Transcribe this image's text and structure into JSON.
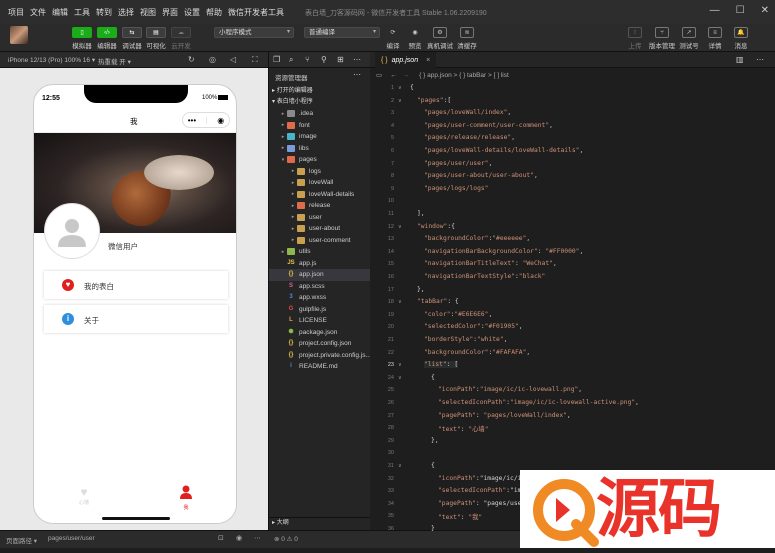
{
  "menu": {
    "items": [
      "项目",
      "文件",
      "编辑",
      "工具",
      "转到",
      "选择",
      "视图",
      "界面",
      "设置",
      "帮助",
      "微信开发者工具"
    ],
    "title": "表白墙_刀客源码网 - 微信开发者工具 Stable 1.06.2209190"
  },
  "toolbar": {
    "simulator": "模拟器",
    "editor": "编辑器",
    "debugger": "调试器",
    "visual": "可视化",
    "cloud": "云开发",
    "mode": "小程序模式",
    "compile": "普通编译",
    "compile_label": "编译",
    "preview": "预览",
    "real_debug": "真机调试",
    "clear_cache": "清缓存",
    "upload": "上传",
    "version": "版本管理",
    "test": "测试号",
    "details": "详情",
    "messages": "消息",
    "right_icon_labels": [
      "⇪",
      "⑂",
      "↗",
      "≡",
      "🔔"
    ]
  },
  "simulator": {
    "device": "iPhone 12/13 (Pro) 100% 16 ▾",
    "hot_reload": "热重载 开 ▾"
  },
  "phone": {
    "time": "12:55",
    "battery": "100%",
    "nav_title": "我",
    "user_name": "微信用户",
    "menu_items": [
      {
        "icon": "heart-icon",
        "label": "我的表白",
        "color": "#e02020"
      },
      {
        "icon": "info-icon",
        "label": "关于",
        "color": "#2f8fdc"
      }
    ],
    "tabs": [
      {
        "label": "心墙",
        "color": "#cccccc"
      },
      {
        "label": "我",
        "color": "#e02020"
      }
    ]
  },
  "bottom": {
    "path_label": "页面路径 ▾",
    "path": "pages/user/user",
    "status": "⊗ 0 ⚠ 0"
  },
  "explorer": {
    "title": "资源管理器",
    "open_editors": "打开的编辑器",
    "project": "表白墙小程序",
    "outline": "大纲",
    "tree": [
      {
        "name": ".idea",
        "depth": 1,
        "type": "folder",
        "color": "#8a8a8a",
        "arrow": "▸"
      },
      {
        "name": "font",
        "depth": 1,
        "type": "folder",
        "color": "#e06b4a",
        "arrow": "▸"
      },
      {
        "name": "image",
        "depth": 1,
        "type": "folder",
        "color": "#4ab3c8",
        "arrow": "▸"
      },
      {
        "name": "libs",
        "depth": 1,
        "type": "folder",
        "color": "#7a9ad8",
        "arrow": "▸"
      },
      {
        "name": "pages",
        "depth": 1,
        "type": "folder",
        "color": "#e06b4a",
        "arrow": "▾"
      },
      {
        "name": "logs",
        "depth": 2,
        "type": "folder",
        "color": "#c8a050",
        "arrow": "▸"
      },
      {
        "name": "loveWall",
        "depth": 2,
        "type": "folder",
        "color": "#c8a050",
        "arrow": "▸"
      },
      {
        "name": "loveWall-details",
        "depth": 2,
        "type": "folder",
        "color": "#c8a050",
        "arrow": "▸"
      },
      {
        "name": "release",
        "depth": 2,
        "type": "folder",
        "color": "#e06b4a",
        "arrow": "▸"
      },
      {
        "name": "user",
        "depth": 2,
        "type": "folder",
        "color": "#c8a050",
        "arrow": "▸"
      },
      {
        "name": "user-about",
        "depth": 2,
        "type": "folder",
        "color": "#c8a050",
        "arrow": "▸"
      },
      {
        "name": "user-comment",
        "depth": 2,
        "type": "folder",
        "color": "#c8a050",
        "arrow": "▸"
      },
      {
        "name": "utils",
        "depth": 1,
        "type": "folder",
        "color": "#8fb84a",
        "arrow": "▸"
      },
      {
        "name": "app.js",
        "depth": 1,
        "type": "js",
        "color": "#e8c84a",
        "arrow": ""
      },
      {
        "name": "app.json",
        "depth": 1,
        "type": "json",
        "color": "#e8c84a",
        "arrow": "",
        "selected": true
      },
      {
        "name": "app.scss",
        "depth": 1,
        "type": "scss",
        "color": "#d86090",
        "arrow": ""
      },
      {
        "name": "app.wxss",
        "depth": 1,
        "type": "wxss",
        "color": "#4a90d8",
        "arrow": ""
      },
      {
        "name": "gulpfile.js",
        "depth": 1,
        "type": "gulp",
        "color": "#e04848",
        "arrow": ""
      },
      {
        "name": "LICENSE",
        "depth": 1,
        "type": "license",
        "color": "#e0a040",
        "arrow": ""
      },
      {
        "name": "package.json",
        "depth": 1,
        "type": "npm",
        "color": "#8fb84a",
        "arrow": ""
      },
      {
        "name": "project.config.json",
        "depth": 1,
        "type": "json",
        "color": "#e8c84a",
        "arrow": ""
      },
      {
        "name": "project.private.config.js...",
        "depth": 1,
        "type": "json",
        "color": "#e8c84a",
        "arrow": ""
      },
      {
        "name": "README.md",
        "depth": 1,
        "type": "info",
        "color": "#4a90d8",
        "arrow": ""
      }
    ]
  },
  "editor": {
    "tab": "app.json",
    "breadcrumb": "{ } app.json > { } tabBar > [ ] list",
    "lines": [
      {
        "n": "1",
        "t": "{",
        "indent": 0
      },
      {
        "n": "2",
        "t": "\"pages\":[",
        "indent": 1
      },
      {
        "n": "3",
        "t": "\"pages/loveWall/index\",",
        "indent": 2
      },
      {
        "n": "4",
        "t": "\"pages/user-comment/user-comment\",",
        "indent": 2
      },
      {
        "n": "5",
        "t": "\"pages/release/release\",",
        "indent": 2
      },
      {
        "n": "6",
        "t": "\"pages/loveWall-details/loveWall-details\",",
        "indent": 2
      },
      {
        "n": "7",
        "t": "\"pages/user/user\",",
        "indent": 2
      },
      {
        "n": "8",
        "t": "\"pages/user-about/user-about\",",
        "indent": 2
      },
      {
        "n": "9",
        "t": "\"pages/logs/logs\"",
        "indent": 2
      },
      {
        "n": "10",
        "t": "",
        "indent": 0
      },
      {
        "n": "11",
        "t": "],",
        "indent": 1
      },
      {
        "n": "12",
        "t": "\"window\":{",
        "indent": 1
      },
      {
        "n": "13",
        "t": "\"backgroundColor\":\"#eeeeee\",",
        "indent": 2
      },
      {
        "n": "14",
        "t": "\"navigationBarBackgroundColor\": \"#FF0000\",",
        "indent": 2
      },
      {
        "n": "15",
        "t": "\"navigationBarTitleText\": \"WeChat\",",
        "indent": 2
      },
      {
        "n": "16",
        "t": "\"navigationBarTextStyle\":\"black\"",
        "indent": 2
      },
      {
        "n": "17",
        "t": "},",
        "indent": 1
      },
      {
        "n": "18",
        "t": "\"tabBar\": {",
        "indent": 1
      },
      {
        "n": "19",
        "t": "\"color\":\"#E6E6E6\",",
        "indent": 2
      },
      {
        "n": "20",
        "t": "\"selectedColor\":\"#F01905\",",
        "indent": 2
      },
      {
        "n": "21",
        "t": "\"borderStyle\":\"white\",",
        "indent": 2
      },
      {
        "n": "22",
        "t": "\"backgroundColor\":\"#FAFAFA\",",
        "indent": 2
      },
      {
        "n": "23",
        "t": "\"list\": [",
        "indent": 2
      },
      {
        "n": "24",
        "t": "{",
        "indent": 3
      },
      {
        "n": "25",
        "t": "\"iconPath\":\"image/ic/ic-lovewall.png\",",
        "indent": 4
      },
      {
        "n": "26",
        "t": "\"selectedIconPath\":\"image/ic/ic-lovewall-active.png\",",
        "indent": 4
      },
      {
        "n": "27",
        "t": "\"pagePath\": \"pages/loveWall/index\",",
        "indent": 4
      },
      {
        "n": "28",
        "t": "\"text\": \"心墙\"",
        "indent": 4
      },
      {
        "n": "29",
        "t": "},",
        "indent": 3
      },
      {
        "n": "30",
        "t": "",
        "indent": 0
      },
      {
        "n": "31",
        "t": "{",
        "indent": 3
      },
      {
        "n": "32",
        "t": "\"iconPath\":\"image/ic/ic-",
        "indent": 4
      },
      {
        "n": "33",
        "t": "\"selectedIconPath\":\"image/ic",
        "indent": 4
      },
      {
        "n": "34",
        "t": "\"pagePath\": \"pages/user/",
        "indent": 4
      },
      {
        "n": "35",
        "t": "\"text\": \"我\"",
        "indent": 4
      },
      {
        "n": "36",
        "t": "}",
        "indent": 3
      }
    ]
  },
  "watermark": {
    "brand": "Q9源码",
    "colors": {
      "orange": "#f08a24",
      "red": "#e8322a"
    }
  },
  "colors": {
    "green_button": "#1aad19",
    "selected_tab": "#e02020"
  }
}
